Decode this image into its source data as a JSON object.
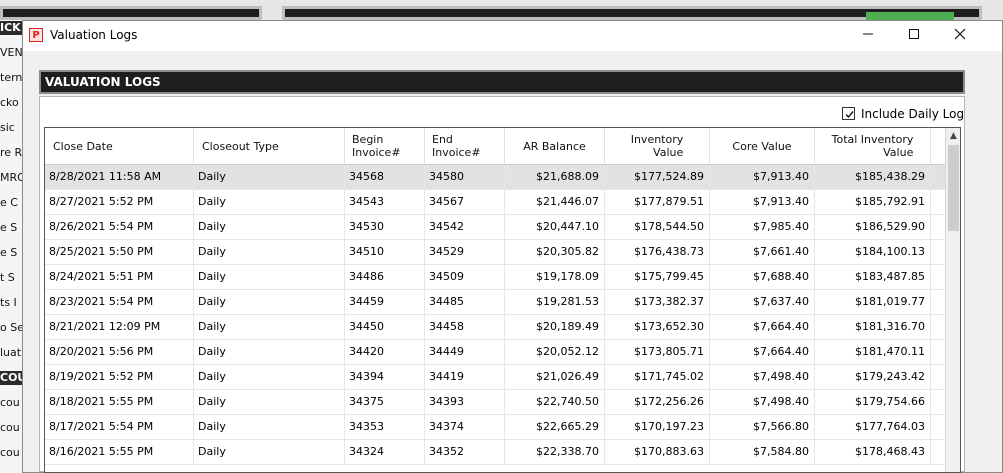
{
  "background_sidebar": {
    "items": [
      "ICK",
      "VENT",
      "tern",
      "cko",
      "sic",
      "re R",
      "MRO",
      "e C",
      "e S",
      "e S",
      "t S",
      "ts I",
      "o Se",
      "luat",
      "COU",
      "cou",
      "cou",
      "cou"
    ]
  },
  "window": {
    "title": "Valuation Logs",
    "icon_letter": "P",
    "minimize": "—",
    "maximize": "☐",
    "close": "✕"
  },
  "panel": {
    "header": "VALUATION LOGS",
    "include_daily_log_label": "Include Daily Log",
    "include_daily_log_checked": true
  },
  "table": {
    "columns": [
      "Close Date",
      "Closeout Type",
      "Begin\nInvoice#",
      "End\nInvoice#",
      "AR Balance",
      "Inventory\nValue",
      "Core Value",
      "Total Inventory\nValue"
    ],
    "selected_row": 0,
    "rows": [
      [
        "8/28/2021 11:58 AM",
        "Daily",
        "34568",
        "34580",
        "$21,688.09",
        "$177,524.89",
        "$7,913.40",
        "$185,438.29"
      ],
      [
        "8/27/2021 5:52 PM",
        "Daily",
        "34543",
        "34567",
        "$21,446.07",
        "$177,879.51",
        "$7,913.40",
        "$185,792.91"
      ],
      [
        "8/26/2021 5:54 PM",
        "Daily",
        "34530",
        "34542",
        "$20,447.10",
        "$178,544.50",
        "$7,985.40",
        "$186,529.90"
      ],
      [
        "8/25/2021 5:50 PM",
        "Daily",
        "34510",
        "34529",
        "$20,305.82",
        "$176,438.73",
        "$7,661.40",
        "$184,100.13"
      ],
      [
        "8/24/2021 5:51 PM",
        "Daily",
        "34486",
        "34509",
        "$19,178.09",
        "$175,799.45",
        "$7,688.40",
        "$183,487.85"
      ],
      [
        "8/23/2021 5:54 PM",
        "Daily",
        "34459",
        "34485",
        "$19,281.53",
        "$173,382.37",
        "$7,637.40",
        "$181,019.77"
      ],
      [
        "8/21/2021 12:09 PM",
        "Daily",
        "34450",
        "34458",
        "$20,189.49",
        "$173,652.30",
        "$7,664.40",
        "$181,316.70"
      ],
      [
        "8/20/2021 5:56 PM",
        "Daily",
        "34420",
        "34449",
        "$20,052.12",
        "$173,805.71",
        "$7,664.40",
        "$181,470.11"
      ],
      [
        "8/19/2021 5:52 PM",
        "Daily",
        "34394",
        "34419",
        "$21,026.49",
        "$171,745.02",
        "$7,498.40",
        "$179,243.42"
      ],
      [
        "8/18/2021 5:55 PM",
        "Daily",
        "34375",
        "34393",
        "$22,740.50",
        "$172,256.26",
        "$7,498.40",
        "$179,754.66"
      ],
      [
        "8/17/2021 5:54 PM",
        "Daily",
        "34353",
        "34374",
        "$22,665.29",
        "$170,197.23",
        "$7,566.80",
        "$177,764.03"
      ],
      [
        "8/16/2021 5:55 PM",
        "Daily",
        "34324",
        "34352",
        "$22,338.70",
        "$170,883.63",
        "$7,584.80",
        "$178,468.43"
      ]
    ]
  }
}
